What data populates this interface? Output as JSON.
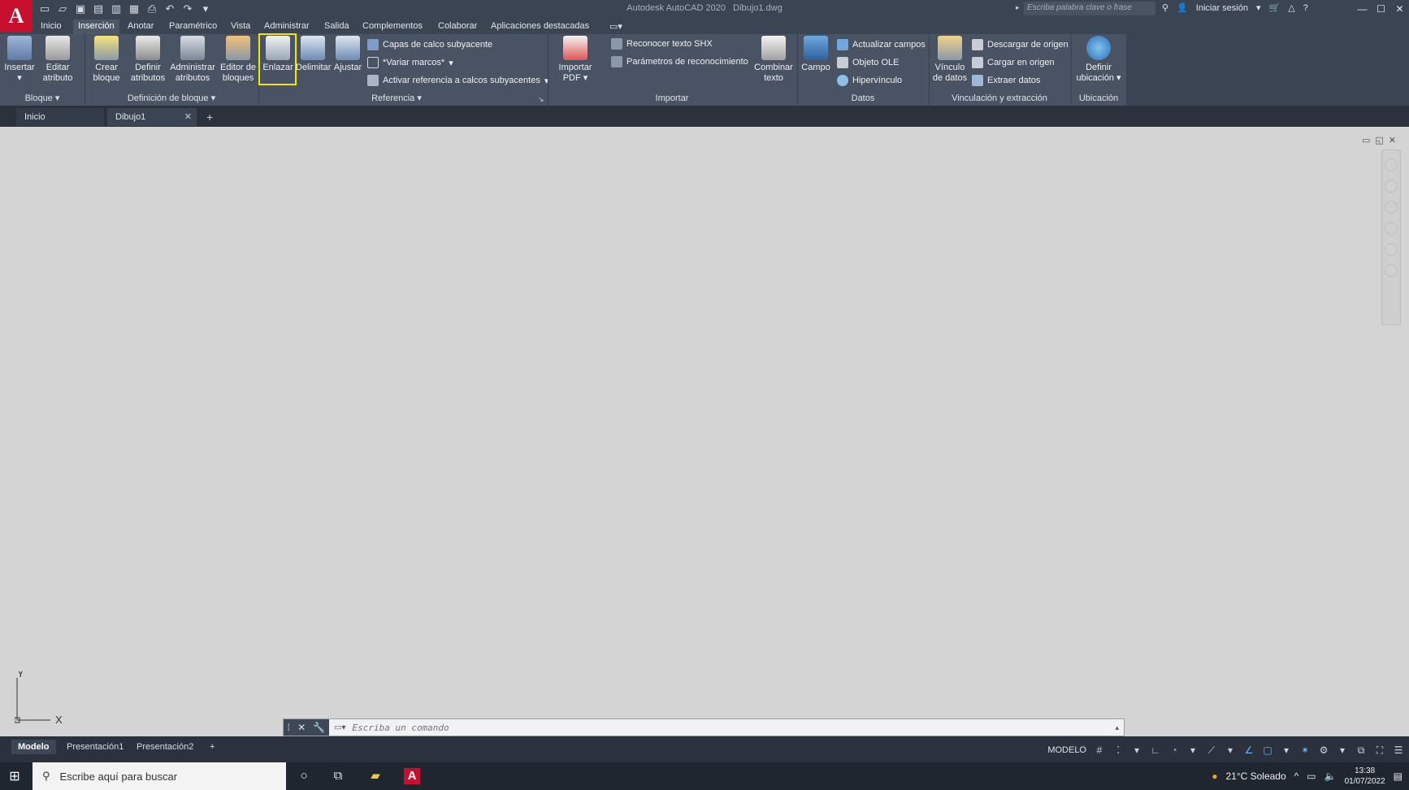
{
  "titlebar": {
    "app_title": "Autodesk AutoCAD 2020",
    "file_name": "Dibujo1.dwg",
    "search_placeholder": "Escriba palabra clave o frase",
    "sign_in": "Iniciar sesión"
  },
  "menu": {
    "tabs": [
      "Inicio",
      "Inserción",
      "Anotar",
      "Paramétrico",
      "Vista",
      "Administrar",
      "Salida",
      "Complementos",
      "Colaborar",
      "Aplicaciones destacadas"
    ]
  },
  "ribbon": {
    "bloque": {
      "title": "Bloque",
      "insertar": "Insertar",
      "editar_atributo_1": "Editar",
      "editar_atributo_2": "atributo"
    },
    "definicion": {
      "title": "Definición de bloque",
      "crear_1": "Crear",
      "crear_2": "bloque",
      "definir_1": "Definir",
      "definir_2": "atributos",
      "admin_1": "Administrar",
      "admin_2": "atributos",
      "editor_1": "Editor de",
      "editor_2": "bloques"
    },
    "referencia": {
      "title": "Referencia",
      "enlazar": "Enlazar",
      "delimitar": "Delimitar",
      "ajustar": "Ajustar",
      "capas": "Capas de calco subyacente",
      "variar": "*Variar marcos*",
      "activar": "Activar referencia a calcos subyacentes"
    },
    "importar": {
      "title": "Importar",
      "pdf_1": "Importar",
      "pdf_2": "PDF",
      "reconocer": "Reconocer texto SHX",
      "parametros": "Parámetros de reconocimiento",
      "combinar_1": "Combinar",
      "combinar_2": "texto"
    },
    "datos": {
      "title": "Datos",
      "campo": "Campo",
      "actualizar": "Actualizar campos",
      "ole": "Objeto OLE",
      "hipervinculo": "Hipervínculo"
    },
    "vinculacion": {
      "title": "Vinculación y extracción",
      "vinculo_1": "Vínculo",
      "vinculo_2": "de datos",
      "descargar": "Descargar de origen",
      "cargar": "Cargar en origen",
      "extraer": "Extraer  datos"
    },
    "ubicacion": {
      "title": "Ubicación",
      "definir_1": "Definir",
      "definir_2": "ubicación"
    }
  },
  "doctabs": {
    "home": "Inicio",
    "active": "Dibujo1"
  },
  "ucs": {
    "y": "Y",
    "x": "X"
  },
  "command": {
    "placeholder": "Escriba un comando"
  },
  "layouts": [
    "Modelo",
    "Presentación1",
    "Presentación2"
  ],
  "status": {
    "mode": "MODELO"
  },
  "taskbar": {
    "search": "Escribe aquí para buscar",
    "weather": "21°C  Soleado",
    "time": "13:38",
    "date": "01/07/2022"
  }
}
